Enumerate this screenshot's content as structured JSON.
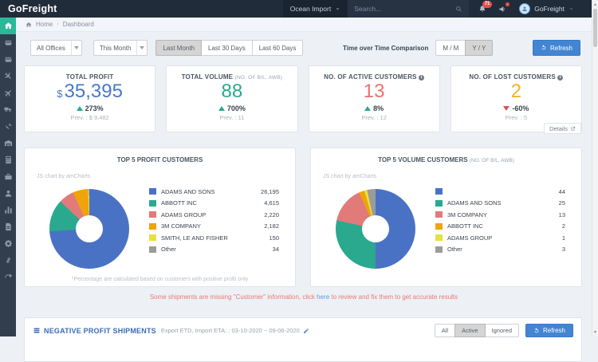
{
  "navbar": {
    "logo": "GoFreight",
    "module_selector": "Ocean Import",
    "search_placeholder": "Search...",
    "notification_count": "71",
    "user_name": "GoFreight"
  },
  "sidebar": {
    "active": "home",
    "items": [
      "home",
      "ocean-import",
      "ocean-export",
      "air-import",
      "air-export",
      "trucking",
      "tracking",
      "warehouse",
      "accounting",
      "management",
      "customers",
      "reports",
      "documents",
      "settings",
      "integrations",
      "export"
    ]
  },
  "breadcrumb": {
    "home": "Home",
    "current": "Dashboard"
  },
  "filters": {
    "office_select": "All Offices",
    "period_select": "This Month",
    "range_buttons": [
      "Last Month",
      "Last 30 Days",
      "Last 60 Days"
    ],
    "active_range": "Last Month",
    "comparison_label": "Time over Time Comparison",
    "comparison_buttons": [
      "M / M",
      "Y / Y"
    ],
    "active_comparison": "Y / Y",
    "refresh_label": "Refresh"
  },
  "kpi_cards": [
    {
      "title": "TOTAL PROFIT",
      "subtitle": "",
      "info": false,
      "value_prefix": "$",
      "value": "35,395",
      "value_color": "#4a77c8",
      "trend": "up",
      "change": "273%",
      "prev": "Prev. : $ 9,482"
    },
    {
      "title": "TOTAL VOLUME",
      "subtitle": "(NO. OF B/L, AWB)",
      "info": false,
      "value_prefix": "",
      "value": "88",
      "value_color": "#2aa98f",
      "trend": "up",
      "change": "700%",
      "prev": "Prev. : 11"
    },
    {
      "title": "NO. OF ACTIVE CUSTOMERS",
      "subtitle": "",
      "info": true,
      "value_prefix": "",
      "value": "13",
      "value_color": "#ee6f6f",
      "trend": "up",
      "change": "8%",
      "prev": "Prev. : 12"
    },
    {
      "title": "NO. OF LOST CUSTOMERS",
      "subtitle": "",
      "info": true,
      "value_prefix": "",
      "value": "2",
      "value_color": "#f0b429",
      "trend": "down",
      "change": "-60%",
      "prev": "Prev. : 5"
    }
  ],
  "details_link": "Details",
  "chart_data": [
    {
      "type": "pie",
      "title": "TOP 5 PROFIT CUSTOMERS",
      "subtitle": "",
      "watermark": "JS chart by amCharts",
      "labels": [
        "ADAMS AND SONS",
        "ABBOTT INC",
        "ADAMS GROUP",
        "3M COMPANY",
        "SMITH, LE AND FISHER",
        "Other"
      ],
      "values": [
        26195,
        4615,
        2220,
        2182,
        150,
        34
      ],
      "display_values": [
        "26,195",
        "4,615",
        "2,220",
        "2,182",
        "150",
        "34"
      ],
      "colors": [
        "#4a72c4",
        "#2aa98f",
        "#e07b7a",
        "#f0a30a",
        "#e5e043",
        "#9b9b9b"
      ],
      "legend_position": "right",
      "footnote": "*Percentage are calculated based on customers with positive profit only"
    },
    {
      "type": "pie",
      "title": "TOP 5 VOLUME CUSTOMERS",
      "subtitle": "(NO. OF B/L, AWB)",
      "watermark": "JS chart by amCharts",
      "labels": [
        "",
        "ADAMS AND SONS",
        "3M COMPANY",
        "ABBOTT INC",
        "ADAMS GROUP",
        "Other"
      ],
      "values": [
        44,
        25,
        13,
        2,
        1,
        3
      ],
      "display_values": [
        "44",
        "25",
        "13",
        "2",
        "1",
        "3"
      ],
      "colors": [
        "#4a72c4",
        "#2aa98f",
        "#e07b7a",
        "#f0a30a",
        "#e5e043",
        "#9b9b9b"
      ],
      "legend_position": "right",
      "footnote": ""
    }
  ],
  "warning": {
    "prefix": "Some shipments are missing \"Customer\" information, click ",
    "link": "here",
    "suffix": " to review and fix them to get accurate results"
  },
  "bottom_bar": {
    "title": "NEGATIVE PROFIT SHIPMENTS",
    "date_range": "Export ETD, Import ETA: : 03-10-2020 ~ 09-06-2020",
    "filter_buttons": [
      "All",
      "Active",
      "Ignored"
    ],
    "active_filter": "Active",
    "refresh_label": "Refresh"
  },
  "theme": {
    "accent_blue": "#4285d3",
    "sidebar_active": "#29b99a",
    "trend_up": "#2aa98f",
    "trend_down": "#e05252",
    "warning_red": "#e87a74"
  }
}
